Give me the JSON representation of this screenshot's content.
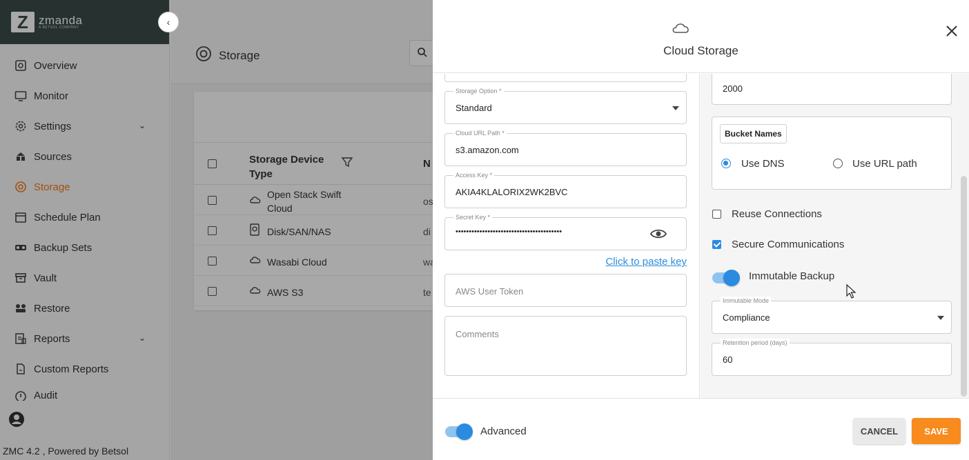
{
  "brand": {
    "name": "zmanda",
    "sub": "A BETSOL COMPANY",
    "logo_letter": "Z"
  },
  "sidebar": {
    "items": [
      {
        "label": "Overview",
        "icon": "overview-icon"
      },
      {
        "label": "Monitor",
        "icon": "monitor-icon"
      },
      {
        "label": "Settings",
        "icon": "gear-icon",
        "expandable": true
      },
      {
        "label": "Sources",
        "icon": "sources-icon"
      },
      {
        "label": "Storage",
        "icon": "storage-icon",
        "active": true
      },
      {
        "label": "Schedule Plan",
        "icon": "calendar-icon"
      },
      {
        "label": "Backup Sets",
        "icon": "backup-sets-icon"
      },
      {
        "label": "Vault",
        "icon": "vault-icon"
      },
      {
        "label": "Restore",
        "icon": "restore-icon"
      },
      {
        "label": "Reports",
        "icon": "reports-icon",
        "expandable": true
      },
      {
        "label": "Custom Reports",
        "icon": "custom-reports-icon"
      },
      {
        "label": "Audit",
        "icon": "audit-icon"
      }
    ],
    "footer": "ZMC 4.2 , Powered by Betsol"
  },
  "page": {
    "title": "Storage",
    "table": {
      "header_type": "Storage Device Type",
      "header_next": "N",
      "rows": [
        {
          "type": "Open Stack Swift Cloud",
          "icon": "cloud-icon",
          "next": "os"
        },
        {
          "type": "Disk/SAN/NAS",
          "icon": "disk-icon",
          "next": "di"
        },
        {
          "type": "Wasabi Cloud",
          "icon": "cloud-icon",
          "next": "wa"
        },
        {
          "type": "AWS S3",
          "icon": "cloud-icon",
          "next": "te"
        }
      ]
    }
  },
  "drawer": {
    "title": "Cloud Storage",
    "left": {
      "storage_option": {
        "label": "Storage Option *",
        "value": "Standard"
      },
      "cloud_url_path": {
        "label": "Cloud URL Path *",
        "value": "s3.amazon.com"
      },
      "access_key": {
        "label": "Access Key *",
        "value": "AKIA4KLALORIX2WK2BVC"
      },
      "secret_key": {
        "label": "Secret Key *",
        "value": "••••••••••••••••••••••••••••••••••••••••"
      },
      "paste_link": "Click to paste key",
      "aws_user_token": {
        "placeholder": "AWS User Token"
      },
      "comments": {
        "placeholder": "Comments"
      }
    },
    "right": {
      "top_value": "2000",
      "bucket_names": {
        "title": "Bucket Names",
        "options": [
          "Use DNS",
          "Use URL path"
        ],
        "selected": "Use DNS"
      },
      "reuse_connections": {
        "label": "Reuse Connections",
        "checked": false
      },
      "secure_communications": {
        "label": "Secure Communications",
        "checked": true
      },
      "immutable_backup": {
        "label": "Immutable Backup",
        "on": true
      },
      "immutable_mode": {
        "label": "Immutable Mode",
        "value": "Compliance"
      },
      "retention_period": {
        "label": "Retention period (days)",
        "value": "60"
      }
    },
    "footer": {
      "advanced_label": "Advanced",
      "advanced_on": true,
      "cancel": "CANCEL",
      "save": "SAVE"
    }
  },
  "colors": {
    "accent": "#2a8be0",
    "brand_dark": "#3b4b4a",
    "active_nav": "#f27a1a",
    "save": "#f78b1e"
  }
}
